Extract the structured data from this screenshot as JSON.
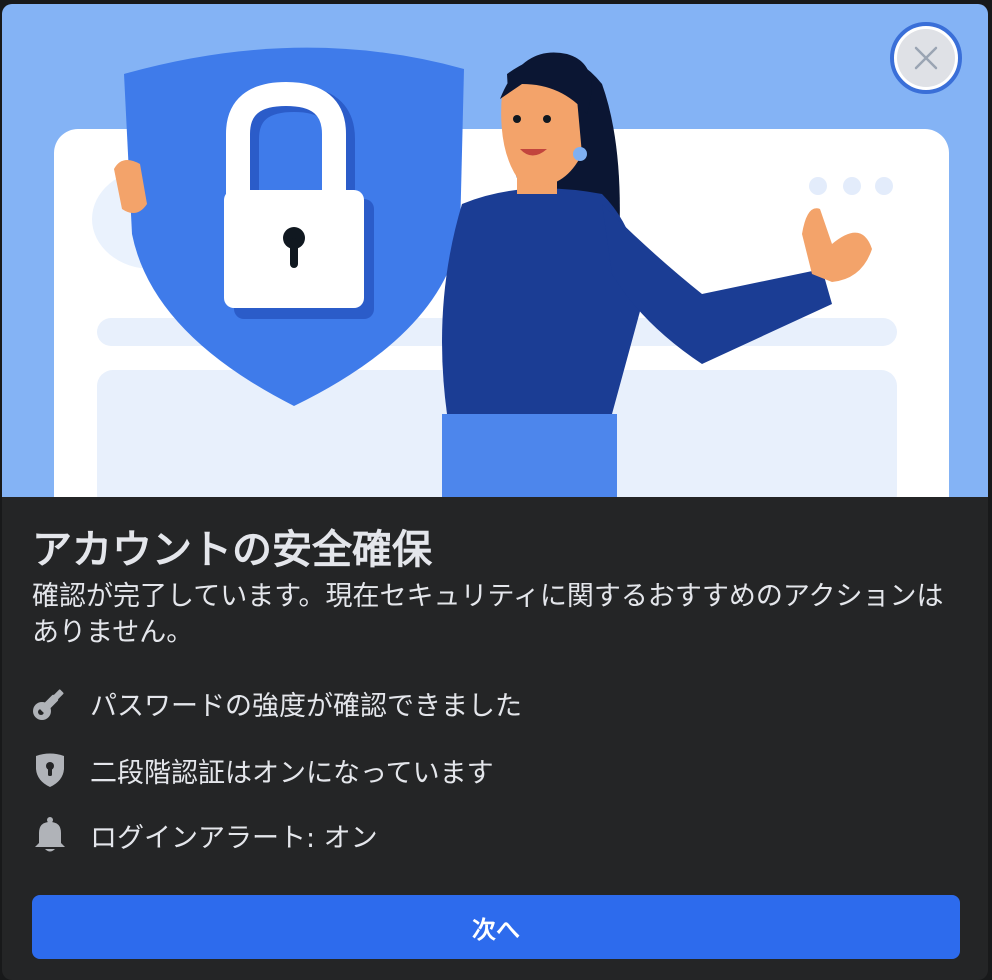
{
  "dialog": {
    "title": "アカウントの安全確保",
    "description": "確認が完了しています。現在セキュリティに関するおすすめのアクションはありません。",
    "close_icon": "close-icon"
  },
  "status_items": [
    {
      "icon": "key-icon",
      "label": "パスワードの強度が確認できました"
    },
    {
      "icon": "shield-lock-icon",
      "label": "二段階認証はオンになっています"
    },
    {
      "icon": "bell-icon",
      "label": "ログインアラート: オン"
    }
  ],
  "next_button": {
    "label": "次へ"
  },
  "colors": {
    "primary": "#2d6bed",
    "dialog_bg": "#242526",
    "text": "#e4e6eb",
    "icon_gray": "#b0b3b8",
    "hero_bg": "#84b3f5"
  }
}
